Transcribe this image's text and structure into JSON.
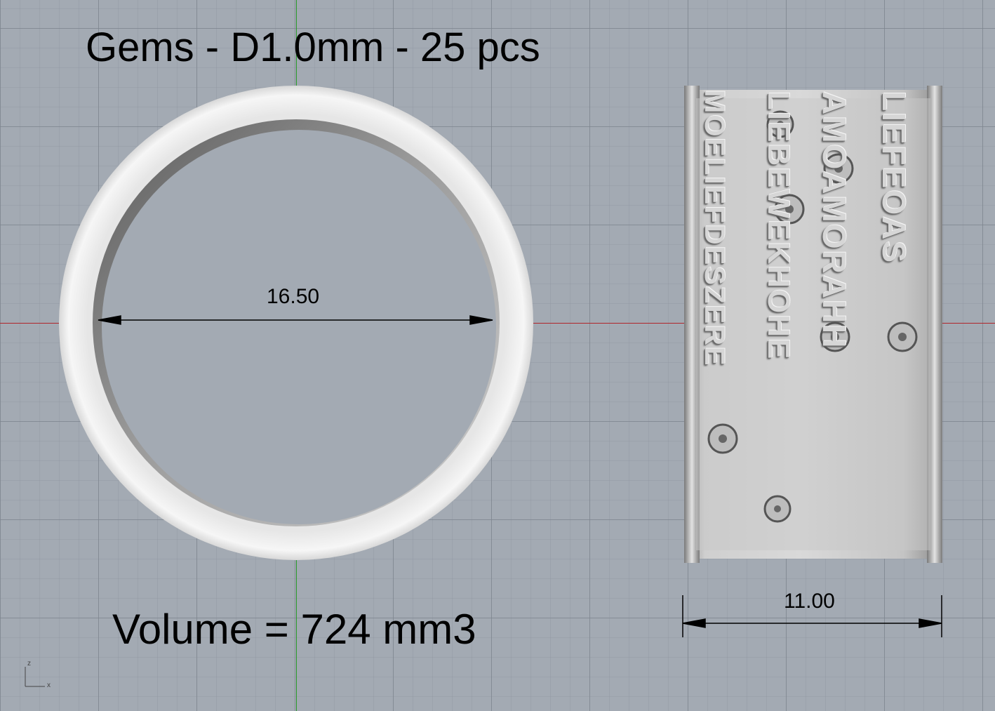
{
  "viewport": {
    "title": "Gems - D1.0mm - 25 pcs",
    "volume_label": "Volume = 724 mm3",
    "dimensions": {
      "diameter": "16.50",
      "width": "11.00"
    },
    "axis_gizmo": {
      "z": "z",
      "x": "x"
    },
    "colors": {
      "background": "#a3aab3",
      "x_axis": "#b0252a",
      "y_axis": "#2a9a2a",
      "ring": "#c9c9c9"
    },
    "band_text": {
      "col1": "MOELIEFDESZERE",
      "col2": "LIEBEWEKHOHE",
      "col3": "AMOAMORAHH",
      "col4": "LIEFEOAS"
    }
  }
}
